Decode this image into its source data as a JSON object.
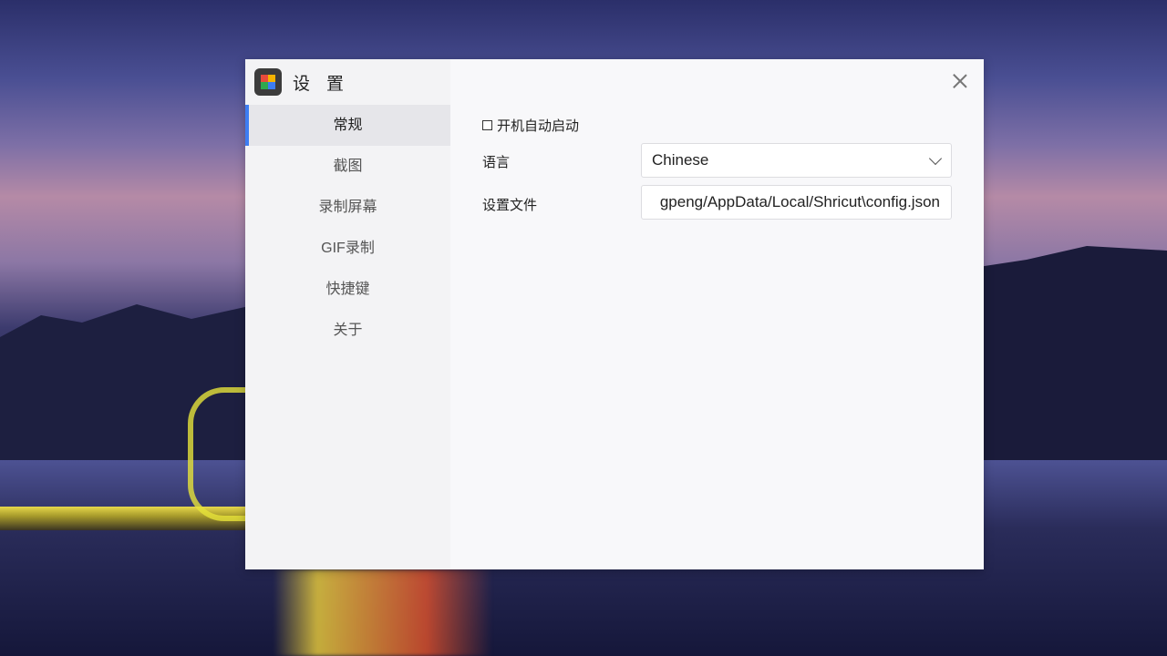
{
  "window": {
    "title": "设 置"
  },
  "sidebar": {
    "items": [
      {
        "label": "常规"
      },
      {
        "label": "截图"
      },
      {
        "label": "录制屏幕"
      },
      {
        "label": "GIF录制"
      },
      {
        "label": "快捷键"
      },
      {
        "label": "关于"
      }
    ]
  },
  "general": {
    "autostart_label": "开机自动启动",
    "autostart_checked": false,
    "language_label": "语言",
    "language_value": "Chinese",
    "config_file_label": "设置文件",
    "config_file_value": "gpeng/AppData/Local/Shricut\\config.json"
  },
  "colors": {
    "accent": "#3d7df2"
  }
}
